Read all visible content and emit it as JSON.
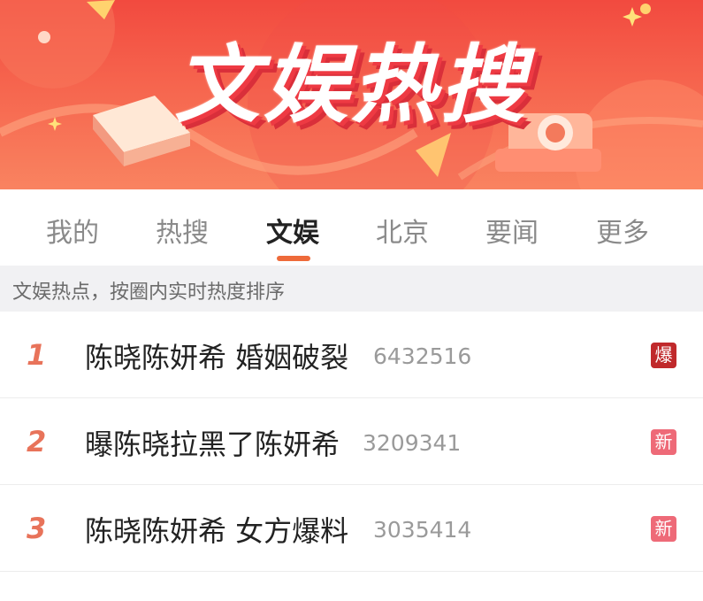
{
  "banner": {
    "title": "文娱热搜"
  },
  "tabs": [
    "我的",
    "热搜",
    "文娱",
    "北京",
    "要闻",
    "更多"
  ],
  "active_tab": "文娱",
  "info": "文娱热点，按圈内实时热度排序",
  "list": [
    {
      "rank": "1",
      "title": "陈晓陈妍希 婚姻破裂",
      "count": "6432516",
      "badge": "爆",
      "badge_type": "hot"
    },
    {
      "rank": "2",
      "title": "曝陈晓拉黑了陈妍希",
      "count": "3209341",
      "badge": "新",
      "badge_type": "new"
    },
    {
      "rank": "3",
      "title": "陈晓陈妍希 女方爆料",
      "count": "3035414",
      "badge": "新",
      "badge_type": "new"
    }
  ],
  "colors": {
    "accent": "#ee6a3a",
    "rank": "#e8735a",
    "badge_hot": "#c0292b",
    "badge_new": "#ee6a78"
  }
}
